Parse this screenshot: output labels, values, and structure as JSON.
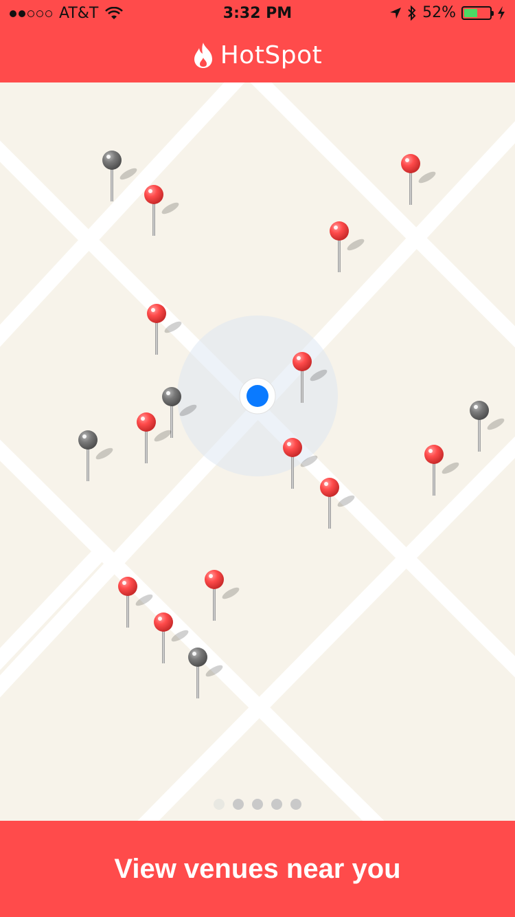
{
  "status_bar": {
    "carrier": "AT&T",
    "signal_bars_filled": 2,
    "signal_bars_total": 5,
    "time": "3:32 PM",
    "battery_percent": "52%",
    "battery_level": 0.52
  },
  "header": {
    "title": "HotSpot",
    "icon": "flame-icon"
  },
  "map": {
    "user_location_icon": "blue-dot-icon",
    "pin_colors": {
      "venue": "#ff4b4b",
      "inactive": "#777777"
    }
  },
  "pager": {
    "count": 5,
    "active_index": 0
  },
  "cta": {
    "label": "View venues near you"
  },
  "colors": {
    "brand": "#ff4b4b",
    "map_background": "#f7f3ea",
    "user_location": "#0a7aff"
  }
}
